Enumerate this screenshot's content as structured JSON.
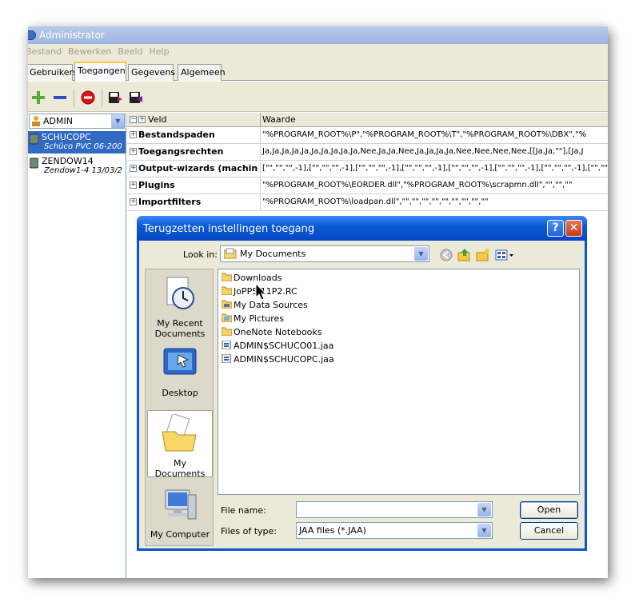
{
  "window": {
    "title": "Administrator"
  },
  "menu": [
    "Bestand",
    "Bewerken",
    "Beeld",
    "Help"
  ],
  "tabs": [
    "Gebruikers",
    "Toegangen",
    "Gegevens",
    "Algemeen"
  ],
  "active_tab": "Toegangen",
  "user_select": {
    "value": "ADMIN"
  },
  "connections": [
    {
      "name": "SCHUCOPC",
      "sub": "Schüco PVC 06-200",
      "selected": true
    },
    {
      "name": "ZENDOW14",
      "sub": "Zendow1-4 13/03/2",
      "selected": false
    }
  ],
  "grid": {
    "col_field": "Veld",
    "col_value": "Waarde",
    "rows": [
      {
        "key": "Bestandspaden",
        "value": "\"%PROGRAM_ROOT%\\P\",\"%PROGRAM_ROOT%\\T\",\"%PROGRAM_ROOT%\\DBX\",\"%"
      },
      {
        "key": "Toegangsrechten",
        "value": "Ja,Ja,Ja,Ja,Ja,Ja,Ja,Ja,Ja,Ja,Nee,Ja,Ja,Nee,Ja,Ja,Ja,Ja,Nee,Nee,Nee,Nee,[[Ja,Ja,\"\"],[Ja,J"
      },
      {
        "key": "Output-wizards (machinest",
        "value": "[\"\",\"\",\"\",-1],[\"\",\"\",\"\",-1],[\"\",\"\",\"\",-1],[\"\",\"\",\"\",-1],[\"\",\"\",\"\",-1],[\"\",\"\",\"\",-1],[\"\",\"\",\"\",-1],[\"\",\"\",\""
      },
      {
        "key": "Plugins",
        "value": "\"%PROGRAM_ROOT%\\EORDER.dll\",\"%PROGRAM_ROOT%\\scrapmn.dll\",\"\",\"\",\"\""
      },
      {
        "key": "Importfilters",
        "value": "\"%PROGRAM_ROOT%\\loadpan.dll\",\"\",\"\",\"\",\"\",\"\",\"\",\"\",\"\",\"\""
      }
    ]
  },
  "dialog": {
    "title": "Terugzetten instellingen toegang",
    "look_in_label": "Look in:",
    "look_in_value": "My Documents",
    "places": [
      "My Recent Documents",
      "Desktop",
      "My Documents",
      "My Computer"
    ],
    "files": [
      {
        "name": "Downloads",
        "icon": "folder-icon"
      },
      {
        "name": "JoPPS 11P2.RC",
        "icon": "folder-icon"
      },
      {
        "name": "My Data Sources",
        "icon": "special-folder-icon"
      },
      {
        "name": "My Pictures",
        "icon": "pictures-folder-icon"
      },
      {
        "name": "OneNote Notebooks",
        "icon": "folder-icon"
      },
      {
        "name": "ADMIN$SCHUCO01.jaa",
        "icon": "file-icon"
      },
      {
        "name": "ADMIN$SCHUCOPC.jaa",
        "icon": "file-icon"
      }
    ],
    "file_name_label": "File name:",
    "file_name_value": "",
    "file_type_label": "Files of type:",
    "file_type_value": "JAA files (*.JAA)",
    "open_label": "Open",
    "cancel_label": "Cancel",
    "help_glyph": "?",
    "close_glyph": "✕"
  },
  "colors": {
    "titlebar": "#0a5ad7",
    "selection": "#316ac5",
    "face": "#ece9d8"
  }
}
